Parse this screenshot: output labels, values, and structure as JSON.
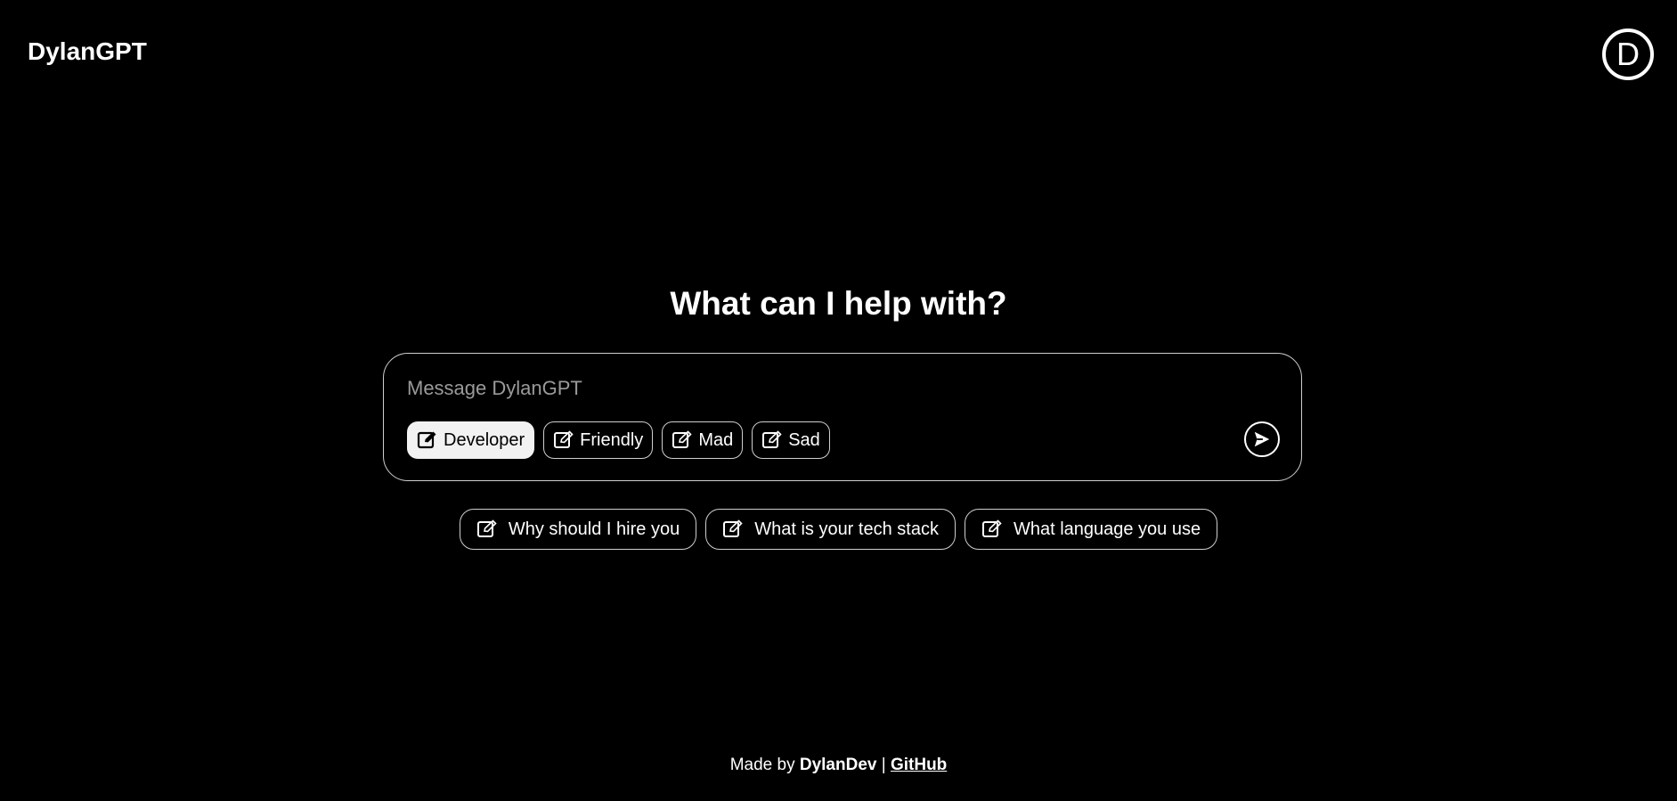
{
  "header": {
    "brand": "DylanGPT",
    "avatar_letter": "D"
  },
  "main": {
    "headline": "What can I help with?",
    "composer": {
      "placeholder": "Message DylanGPT",
      "value": "",
      "modes": [
        {
          "label": "Developer",
          "active": true
        },
        {
          "label": "Friendly",
          "active": false
        },
        {
          "label": "Mad",
          "active": false
        },
        {
          "label": "Sad",
          "active": false
        }
      ],
      "send_icon": "send-arrow-icon"
    },
    "suggestions": [
      {
        "label": "Why should I hire you"
      },
      {
        "label": "What is your tech stack"
      },
      {
        "label": "What language you use"
      }
    ]
  },
  "footer": {
    "prefix": "Made by",
    "author": "DylanDev",
    "separator": "|",
    "link_label": "GitHub"
  },
  "colors": {
    "background": "#000000",
    "foreground": "#ffffff",
    "border": "#cfcfcf",
    "active_chip_bg": "#f2f2f2",
    "placeholder": "#9a9a9a"
  },
  "icons": {
    "chip_icon": "edit-icon",
    "suggestion_icon": "edit-icon"
  }
}
